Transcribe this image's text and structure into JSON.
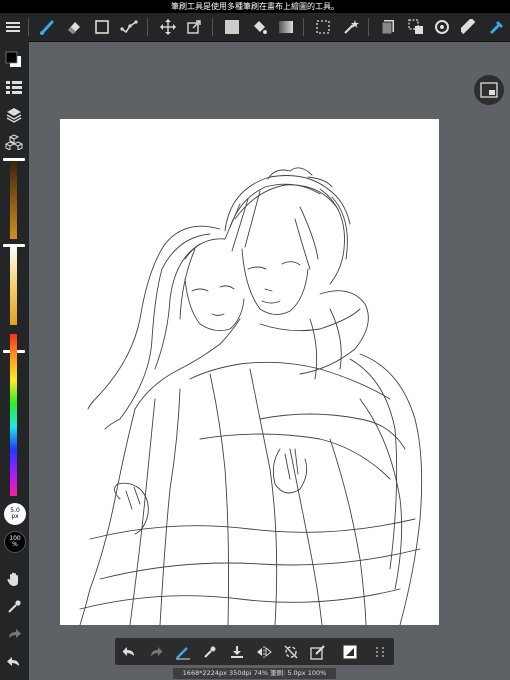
{
  "status_bar": {
    "tooltip": "筆刷工具是使用多種筆刷在畫布上繪圖的工具。"
  },
  "toolbar": {
    "icons": [
      "menu-icon",
      "brush-icon",
      "eraser-icon",
      "rectangle-icon",
      "pen-curve-icon",
      "move-icon",
      "transform-icon",
      "fill-color-icon",
      "bucket-icon",
      "gradient-icon",
      "select-icon",
      "magic-wand-icon",
      "layers-panel-icon",
      "selection-icon",
      "rotate-icon",
      "ruler-icon",
      "pen-settings-icon"
    ]
  },
  "left_panel": {
    "brush_size": {
      "value": "5.0",
      "unit": "px"
    },
    "opacity": {
      "value": "100",
      "unit": "%"
    }
  },
  "colors": {
    "accent": "#3aa8e6",
    "panel": "#232527",
    "workspace": "#5e6266"
  },
  "bottom_toolbar": {
    "icons": [
      "undo-icon",
      "redo-icon",
      "stabilizer-icon",
      "eyedropper-icon",
      "import-icon",
      "flip-icon",
      "snap-off-icon",
      "edit-icon",
      "layer-icon",
      "grid-icon"
    ]
  },
  "status": {
    "info": "1668*2224px 350dpi 74% 筆刷: 5.0px 100%"
  }
}
